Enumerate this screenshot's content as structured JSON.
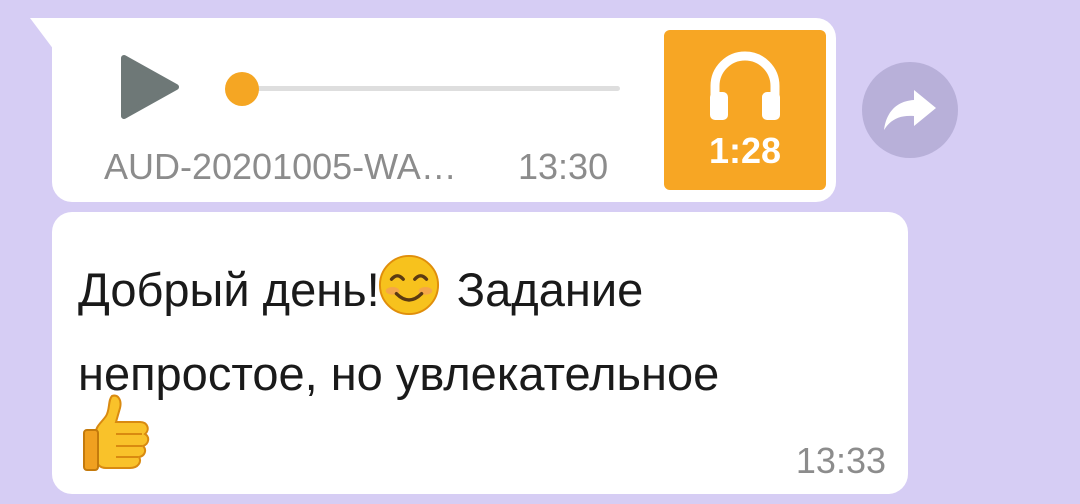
{
  "audio_message": {
    "file_name": "AUD-20201005-WA…",
    "time": "13:30",
    "duration": "1:28",
    "progress": 0.0,
    "play_icon": "play-icon",
    "listen_icon": "headphones-icon"
  },
  "forward": {
    "icon": "forward-arrow-icon"
  },
  "text_message": {
    "line1_part1": "Добрый день!",
    "line1_part2": " Задание",
    "line2": "непростое, но увлекательное",
    "emoji_smile": "smiling-face-emoji",
    "emoji_thumb": "thumbs-up-emoji",
    "time": "13:33"
  },
  "colors": {
    "background": "#d6cdf4",
    "bubble": "#ffffff",
    "accent": "#f7a624",
    "muted_text": "#8c8c8c",
    "forward_button": "#b8b0d9"
  }
}
